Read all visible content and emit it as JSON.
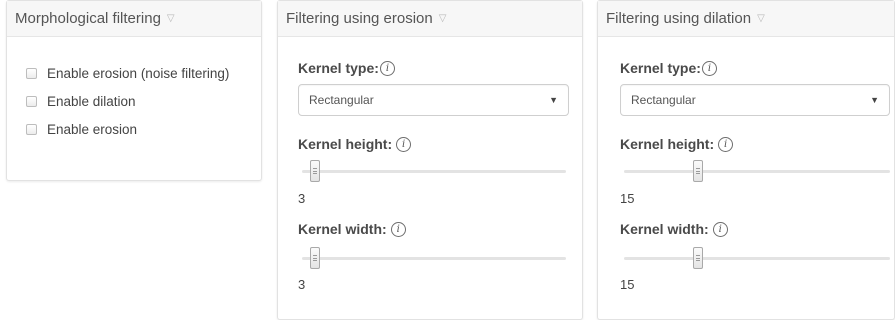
{
  "panels": {
    "morph": {
      "title": "Morphological filtering",
      "checkboxes": [
        {
          "label": "Enable erosion (noise filtering)",
          "checked": false
        },
        {
          "label": "Enable dilation",
          "checked": false
        },
        {
          "label": "Enable erosion",
          "checked": false
        }
      ]
    },
    "erosion": {
      "title": "Filtering using erosion",
      "kernel_type_label": "Kernel type:",
      "kernel_type_value": "Rectangular",
      "kernel_height_label": "Kernel height:",
      "kernel_height_value": "3",
      "kernel_width_label": "Kernel width:",
      "kernel_width_value": "3"
    },
    "dilation": {
      "title": "Filtering using dilation",
      "kernel_type_label": "Kernel type:",
      "kernel_type_value": "Rectangular",
      "kernel_height_label": "Kernel height:",
      "kernel_height_value": "15",
      "kernel_width_label": "Kernel width:",
      "kernel_width_value": "15"
    }
  },
  "icons": {
    "collapse": "chevron-down-icon",
    "info": "info-icon",
    "select_arrow": "caret-down-icon"
  },
  "info_glyph": "i",
  "slider_levels": {
    "erosion_height": 0.03,
    "erosion_width": 0.03,
    "dilation_height": 0.27,
    "dilation_width": 0.27
  },
  "colors": {
    "header_bg": "#f7f7f7",
    "border": "#e2e2e2",
    "track": "#e3e3e3"
  }
}
